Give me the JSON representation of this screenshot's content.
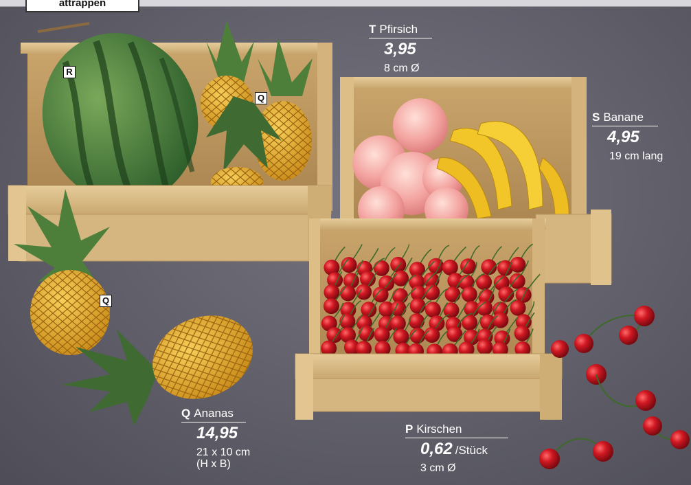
{
  "header_tag": "attrappen",
  "badges": {
    "watermelon": "R",
    "pineapple_crate": "Q",
    "pineapple_left": "Q"
  },
  "labels": {
    "pfirsich": {
      "letter": "T",
      "name": "Pfirsich",
      "price": "3,95",
      "size": "8 cm Ø"
    },
    "banane": {
      "letter": "S",
      "name": "Banane",
      "price": "4,95",
      "size": "19 cm lang"
    },
    "ananas": {
      "letter": "Q",
      "name": "Ananas",
      "price": "14,95",
      "size_line1": "21 x 10 cm",
      "size_line2": "(H x B)"
    },
    "kirschen": {
      "letter": "P",
      "name": "Kirschen",
      "price": "0,62",
      "unit": "/Stück",
      "size": "3 cm Ø"
    }
  },
  "colors": {
    "background": "#5f5e69",
    "wood": "#d8b983",
    "cherry": "#c0141c",
    "peach": "#f0a5a0",
    "banana": "#f2c528",
    "pineapple": "#e0a52a",
    "leaf": "#3f6b32",
    "melon": "#2f6a2a"
  }
}
